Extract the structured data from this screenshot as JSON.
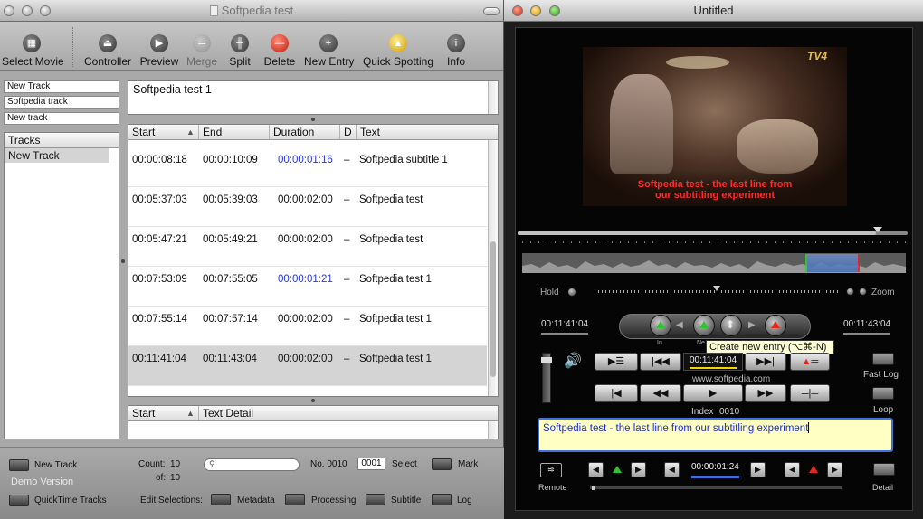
{
  "left_window": {
    "title": "Softpedia test",
    "toolbar": {
      "select_movie": "Select Movie",
      "controller": "Controller",
      "preview": "Preview",
      "merge": "Merge",
      "split": "Split",
      "delete": "Delete",
      "new_entry": "New Entry",
      "quick_spotting": "Quick Spotting",
      "info": "Info"
    },
    "track_fields": [
      "New Track",
      "Softpedia track",
      "New track"
    ],
    "tracks_header": "Tracks",
    "tracks": [
      "New Track"
    ],
    "subtitle_text": "Softpedia test 1",
    "table": {
      "columns": [
        "Start",
        "End",
        "Duration",
        "D",
        "Text"
      ],
      "rows": [
        {
          "start": "00:00:08:18",
          "end": "00:00:10:09",
          "duration": "00:00:01:16",
          "d": "–",
          "text": "Softpedia subtitle 1",
          "dur_highlight": true,
          "selected": false
        },
        {
          "start": "00:05:37:03",
          "end": "00:05:39:03",
          "duration": "00:00:02:00",
          "d": "–",
          "text": "Softpedia test",
          "dur_highlight": false,
          "selected": false
        },
        {
          "start": "00:05:47:21",
          "end": "00:05:49:21",
          "duration": "00:00:02:00",
          "d": "–",
          "text": "Softpedia test",
          "dur_highlight": false,
          "selected": false
        },
        {
          "start": "00:07:53:09",
          "end": "00:07:55:05",
          "duration": "00:00:01:21",
          "d": "–",
          "text": "Softpedia test 1",
          "dur_highlight": true,
          "selected": false
        },
        {
          "start": "00:07:55:14",
          "end": "00:07:57:14",
          "duration": "00:00:02:00",
          "d": "–",
          "text": "Softpedia test 1",
          "dur_highlight": false,
          "selected": false
        },
        {
          "start": "00:11:41:04",
          "end": "00:11:43:04",
          "duration": "00:00:02:00",
          "d": "–",
          "text": "Softpedia test 1",
          "dur_highlight": false,
          "selected": true
        }
      ]
    },
    "detail_columns": [
      "Start",
      "Text Detail"
    ],
    "bottom": {
      "new_track": "New Track",
      "demo_version": "Demo Version",
      "quicktime_tracks": "QuickTime Tracks",
      "count_label": "Count:",
      "count_value": "10",
      "of_label": "of:",
      "of_value": "10",
      "search_placeholder": "",
      "no_label": "No. 0010",
      "no_field_value": "0001",
      "select_label": "Select",
      "mark_label": "Mark",
      "edit_selections": "Edit Selections:",
      "metadata": "Metadata",
      "processing": "Processing",
      "subtitle": "Subtitle",
      "log": "Log"
    }
  },
  "right_window": {
    "title": "Untitled",
    "video_logo": "TV4",
    "caption_line1": "Softpedia test - the last line from",
    "caption_line2": "our subtitling experiment",
    "hold_label": "Hold",
    "zoom_label": "Zoom",
    "time_left": "00:11:41:04",
    "time_right": "00:11:43:04",
    "in_label": "In",
    "new_label": "Ne",
    "tooltip": "Create new entry (⌥⌘-N)",
    "current_time": "00:11:41:04",
    "watermark": "www.softpedia.com",
    "index_label": "Index",
    "index_value": "0010",
    "fast_log": "Fast Log",
    "loop": "Loop",
    "edit_text": "Softpedia test - the last line from our subtitling experiment",
    "duration_value": "00:00:01:24",
    "remote_label": "Remote",
    "detail_label": "Detail"
  }
}
